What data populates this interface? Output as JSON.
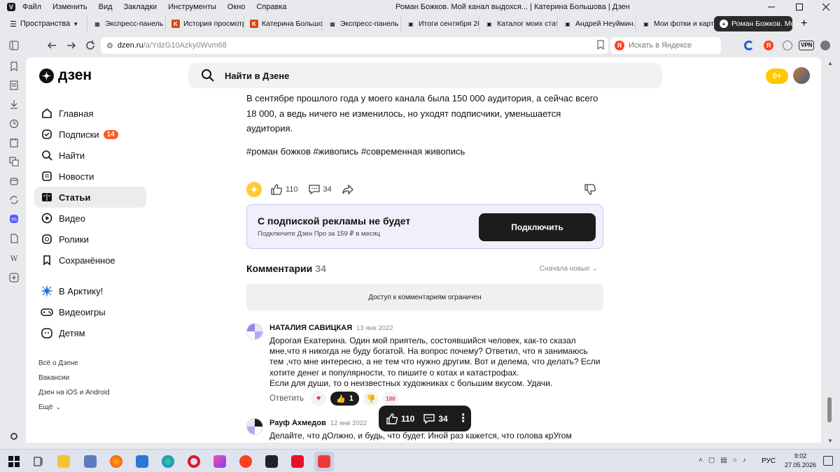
{
  "browser": {
    "menu": [
      "Файл",
      "Изменить",
      "Вид",
      "Закладки",
      "Инструменты",
      "Окно",
      "Справка"
    ],
    "window_title": "Роман Божков. Мой канал выдохся... | Катерина Большова | Дзен",
    "spaces_label": "Пространства",
    "tabs": [
      {
        "label": "Экспресс-панель",
        "icon": "grid-icon"
      },
      {
        "label": "История просмотра",
        "icon": "ke-logo-icon"
      },
      {
        "label": "Катерина Большова",
        "icon": "ke-logo-icon"
      },
      {
        "label": "Экспресс-панель",
        "icon": "grid-icon"
      },
      {
        "label": "Итоги сентября 2021",
        "icon": "page-icon"
      },
      {
        "label": "Каталог моих статей",
        "icon": "page-icon"
      },
      {
        "label": "Андрей Неуймин. О",
        "icon": "page-icon"
      },
      {
        "label": "Мои фотки и картин",
        "icon": "page-icon"
      },
      {
        "label": "Роман Божков. Мой",
        "icon": "dzen-icon"
      }
    ],
    "address": {
      "host": "dzen.ru",
      "path": "/a/YdzG10Azky0Wvm68"
    },
    "search_placeholder": "Искать в Яндексе",
    "vpn_label": "VPN"
  },
  "header": {
    "logo_text": "дзен",
    "search_placeholder": "Найти в Дзене",
    "coins": "0+"
  },
  "sidebar": {
    "items": [
      {
        "label": "Главная",
        "icon": "home-icon"
      },
      {
        "label": "Подписки",
        "icon": "subscriptions-icon",
        "badge": "14"
      },
      {
        "label": "Найти",
        "icon": "search-icon"
      },
      {
        "label": "Новости",
        "icon": "news-icon"
      },
      {
        "label": "Статьи",
        "icon": "articles-icon",
        "selected": true
      },
      {
        "label": "Видео",
        "icon": "video-icon"
      },
      {
        "label": "Ролики",
        "icon": "shorts-icon"
      },
      {
        "label": "Сохранённое",
        "icon": "bookmark-icon"
      }
    ],
    "extra": [
      {
        "label": "В Арктику!",
        "icon": "compass-star-icon"
      },
      {
        "label": "Видеоигры",
        "icon": "gamepad-icon"
      },
      {
        "label": "Детям",
        "icon": "kids-icon"
      }
    ],
    "links": [
      "Всё о Дзене",
      "Вакансии",
      "Дзен на iOS и Android",
      "Ещё"
    ]
  },
  "article": {
    "text": "В сентябре прошлого года у моего канала была 150 000 аудитория, а сейчас всего 18 000, а ведь ничего не изменилось, но уходят подписчики, уменьшается аудитория.",
    "tags": "#роман божков #живопись #современная живопись",
    "likes": "110",
    "comments": "34"
  },
  "promo": {
    "title": "С подпиской рекламы не будет",
    "subtitle": "Подключите Дзен Про за 159 ₽ в месяц",
    "button": "Подключить"
  },
  "comments_section": {
    "title": "Комментарии",
    "count": "34",
    "sort": "Сначала новые",
    "restricted": "Доступ к комментариям ограничен",
    "list": [
      {
        "author": "НАТАЛИЯ САВИЦКАЯ",
        "date": "13 янв 2022",
        "lines": [
          "Дорогая Екатерина. Один мой приятель, состоявшийся человек, как-то сказал",
          "мне,что я никогда не буду богатой. На вопрос почему? Ответил, что я занимаюсь",
          "тем ,что мне интересно, а не тем что нужно другим. Вот и делема, что делать? Если",
          "хотите денег и популярности, то пишите о котах и катастрофах.",
          "Если для души, то о неизвестных художниках с большим вкусом. Удачи."
        ],
        "reply": "Ответить",
        "thumbs_count": "1"
      },
      {
        "author": "Рауф Ахмедов",
        "date": "12 янв 2022",
        "lines": [
          "Делайте, что дОлжно, и будь, что будет. Иной раз кажется, что голова крУгом"
        ]
      }
    ]
  },
  "floatbar": {
    "likes": "110",
    "comments": "34"
  },
  "taskbar": {
    "lang": "РУС",
    "time": "9:02",
    "date": "27.05.2026"
  }
}
